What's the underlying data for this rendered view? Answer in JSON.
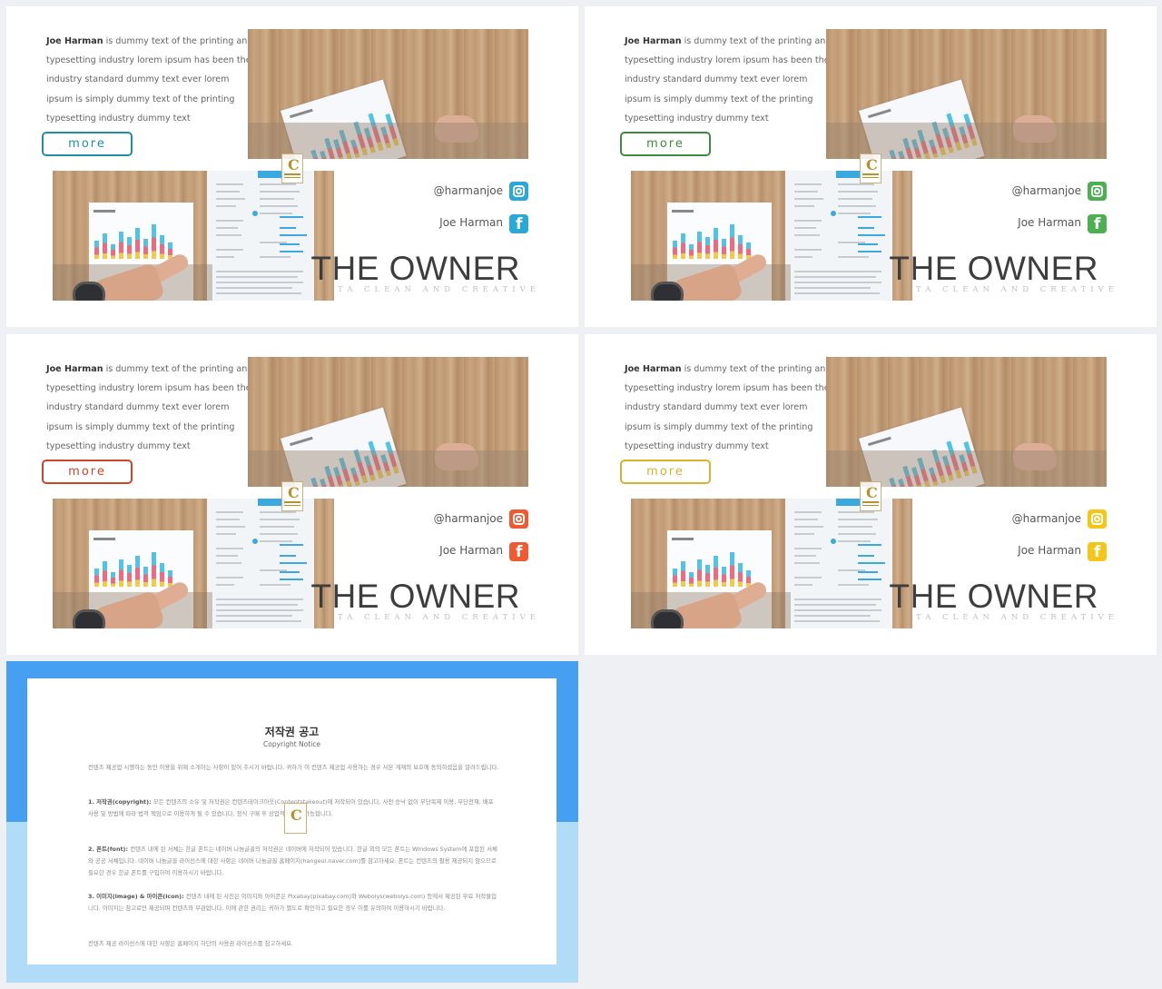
{
  "slides": [
    {
      "variant": "teal",
      "accent": "#1f8fa6",
      "icon_color": "#2aa8d8",
      "body": {
        "name": "Joe Harman",
        "text": " is dummy text of the printing and typesetting industry lorem ipsum has been the industry standard dummy text ever lorem ipsum is simply dummy text of the printing typesetting industry dummy text"
      },
      "more_label": "more",
      "handle": "@harmanjoe",
      "name_label": "Joe Harman",
      "title": "THE OWNER",
      "subline": "TA CLEAN AND CREATIVE"
    },
    {
      "variant": "green",
      "accent": "#3e8a3e",
      "icon_color": "#4caf50",
      "body": {
        "name": "Joe Harman",
        "text": " is dummy text of the printing and typesetting industry lorem ipsum has been the industry standard dummy text ever lorem ipsum is simply dummy text of the printing typesetting industry dummy text"
      },
      "more_label": "more",
      "handle": "@harmanjoe",
      "name_label": "Joe Harman",
      "title": "THE OWNER",
      "subline": "TA CLEAN AND CREATIVE"
    },
    {
      "variant": "red",
      "accent": "#c8472a",
      "icon_color": "#ef5a32",
      "body": {
        "name": "Joe Harman",
        "text": " is dummy text of the printing and typesetting industry lorem ipsum has been the industry standard dummy text ever lorem ipsum is simply dummy text of the printing typesetting industry dummy text"
      },
      "more_label": "more",
      "handle": "@harmanjoe",
      "name_label": "Joe Harman",
      "title": "THE OWNER",
      "subline": "TA CLEAN AND CREATIVE"
    },
    {
      "variant": "yellow",
      "accent": "#d8b22c",
      "icon_color": "#f5c518",
      "body": {
        "name": "Joe Harman",
        "text": " is dummy text of the printing and typesetting industry lorem ipsum has been the industry standard dummy text ever lorem ipsum is simply dummy text of the printing typesetting industry dummy text"
      },
      "more_label": "more",
      "handle": "@harmanjoe",
      "name_label": "Joe Harman",
      "title": "THE OWNER",
      "subline": "TA CLEAN AND CREATIVE"
    }
  ],
  "icons": {
    "instagram": "instagram-icon",
    "facebook": "facebook-icon",
    "logo": "logo-badge-icon"
  },
  "logo_letter": "C",
  "copyright": {
    "title": "저작권 공고",
    "subtitle": "Copyright Notice",
    "intro": "컨텐츠 제공업 시행하는 동안 이용을 위해 소개하는 사항이 있어 주시기 바랍니다. 귀하가 이 컨텐츠 제공업 사용하는 경우 사본 게재의 보호에 동의하셨음을 알려드립니다.",
    "sections": [
      {
        "heading": "1. 저작권(copyright): ",
        "text": "모든 컨텐츠의 소유 및 저작권은 컨텐츠테이크아웃(Contentstakeout)에 저작되어 있습니다. 사전 승낙 없이 무단복제 이용, 무단전재, 배포 사용 및 방법에 따라 법적 책임으로 이용하게 될 수 있습니다. 정식 구매 후 상업적 이용이 가능합니다."
      },
      {
        "heading": "2. 폰트(font): ",
        "text": "컨텐츠 내에 된 서체는 한글 폰트는 네이버 나눔글꼴의 저작권은 네이버에 저작되어 있습니다. 한글 외의 모든 폰트는 Windows System에 포함된 서체와 공공 서체입니다. 네이버 나눔글꼴 라이선스에 대한 사항은 네이버 나눔글꼴 홈페이지(hangeul.naver.com)를 참고하세요. 폰트는 컨텐츠의 활용 제공되지 않으므로 필요한 경우 한글 폰트를 구입하여 이용하시기 바랍니다."
      },
      {
        "heading": "3. 이미지(image) & 아이콘(icon): ",
        "text": "컨텐츠 내에 된 사진은 이미지와 아이콘은 Pixabay(pixabay.com)와 Webolys(webolys.com) 등에서 제공된 무료 저작물입니다. 이미지는 참고로만 제공되며 컨텐츠와 무관합니다. 이에 관한 권리는 귀하가 별도로 확인하고 필요한 경우 이를 유의하여 이용하시기 바랍니다."
      }
    ],
    "outro": "컨텐츠 제공 라이선스에 대한 사항은 홈페이지 하단의 사용권 라이선스를 참고하세요."
  }
}
